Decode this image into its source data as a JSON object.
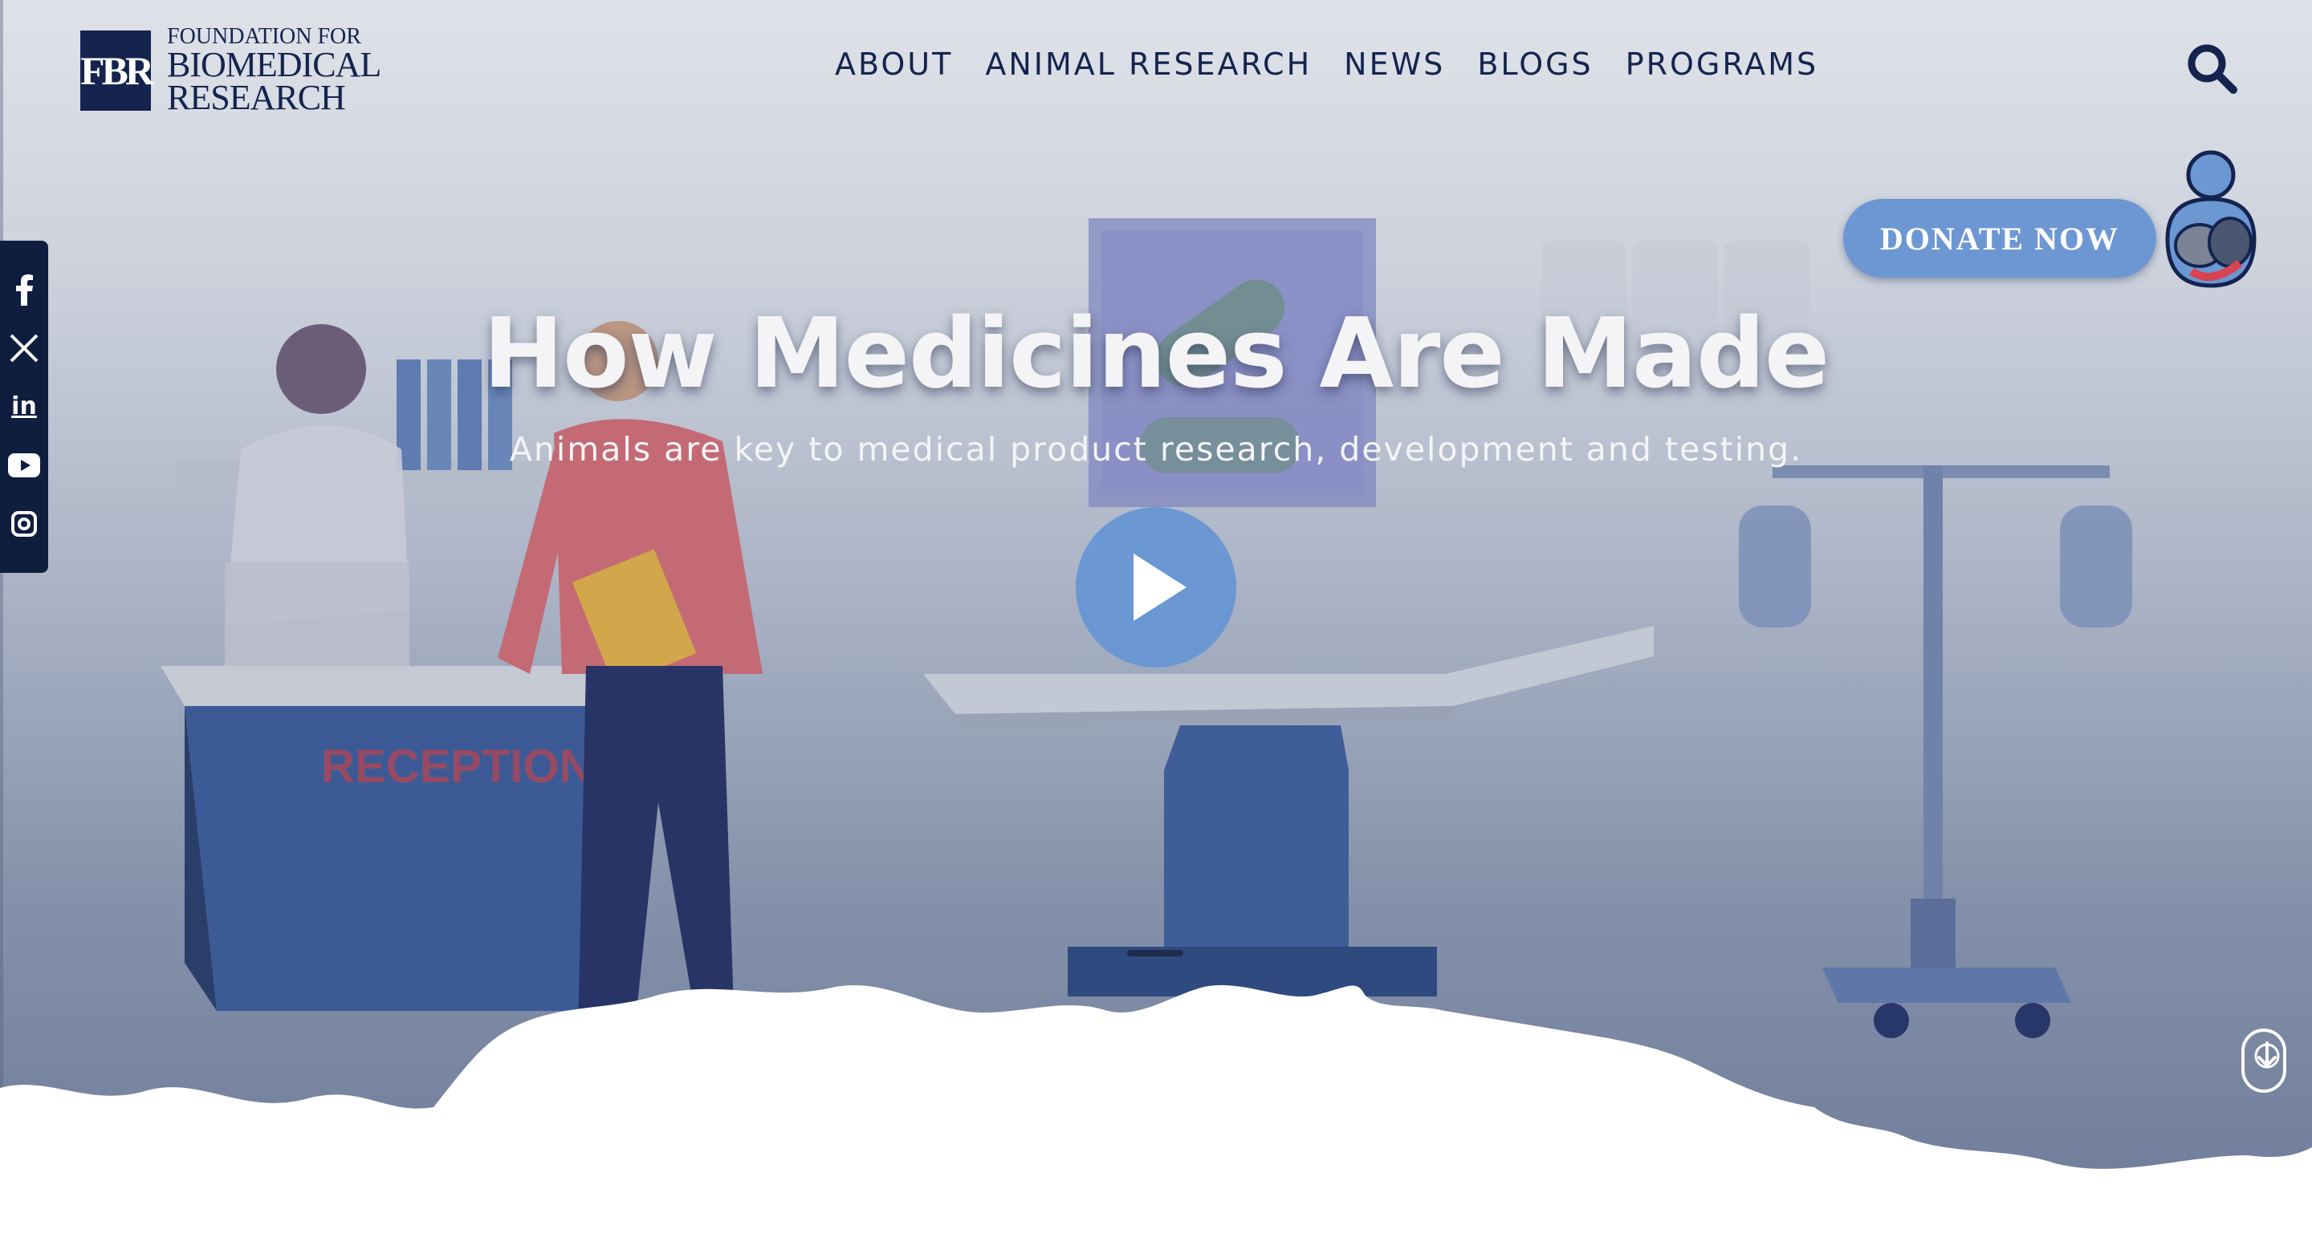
{
  "header": {
    "logo": {
      "mark": "FBR",
      "line1": "FOUNDATION FOR",
      "line2": "BIOMEDICAL",
      "line3": "RESEARCH"
    },
    "nav": [
      {
        "label": "ABOUT"
      },
      {
        "label": "ANIMAL RESEARCH"
      },
      {
        "label": "NEWS"
      },
      {
        "label": "BLOGS"
      },
      {
        "label": "PROGRAMS"
      }
    ],
    "search_icon": "search-icon"
  },
  "donate": {
    "label": "DONATE NOW",
    "badge_icon": "pets-badge-icon"
  },
  "social": [
    {
      "name": "facebook",
      "icon": "facebook-icon"
    },
    {
      "name": "x",
      "icon": "x-icon"
    },
    {
      "name": "linkedin",
      "icon": "linkedin-icon",
      "text": "in"
    },
    {
      "name": "youtube",
      "icon": "youtube-icon"
    },
    {
      "name": "instagram",
      "icon": "instagram-icon"
    }
  ],
  "hero": {
    "title": "How Medicines Are Made",
    "subtitle": "Animals are key to medical product research, development and testing.",
    "illustration_text": "RECEPTION",
    "play_icon": "play-icon",
    "scroll_icon": "scroll-down-icon"
  },
  "colors": {
    "navy": "#14244f",
    "accent_blue": "#6b97d3",
    "white": "#ffffff"
  }
}
